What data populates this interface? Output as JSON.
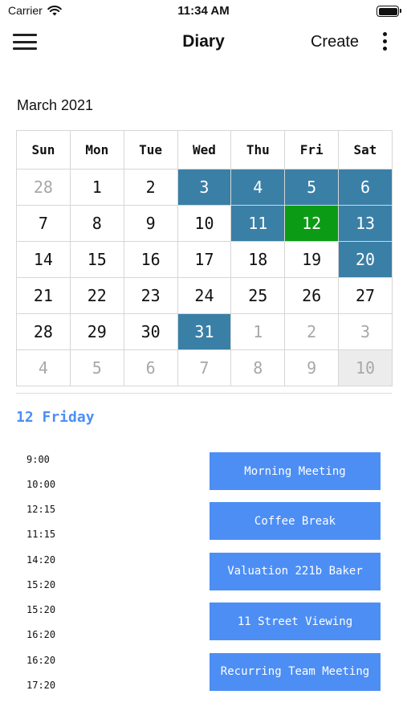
{
  "status_bar": {
    "carrier": "Carrier",
    "time": "11:34 AM",
    "battery_level": 1.0
  },
  "nav": {
    "title": "Diary",
    "create_label": "Create"
  },
  "calendar": {
    "month_label": "March 2021",
    "weekdays": [
      "Sun",
      "Mon",
      "Tue",
      "Wed",
      "Thu",
      "Fri",
      "Sat"
    ],
    "weeks": [
      [
        {
          "day": "28",
          "state": "muted"
        },
        {
          "day": "1",
          "state": "normal"
        },
        {
          "day": "2",
          "state": "normal"
        },
        {
          "day": "3",
          "state": "has-events"
        },
        {
          "day": "4",
          "state": "has-events"
        },
        {
          "day": "5",
          "state": "has-events"
        },
        {
          "day": "6",
          "state": "has-events"
        }
      ],
      [
        {
          "day": "7",
          "state": "normal"
        },
        {
          "day": "8",
          "state": "normal"
        },
        {
          "day": "9",
          "state": "normal"
        },
        {
          "day": "10",
          "state": "normal"
        },
        {
          "day": "11",
          "state": "has-events"
        },
        {
          "day": "12",
          "state": "selected"
        },
        {
          "day": "13",
          "state": "has-events"
        }
      ],
      [
        {
          "day": "14",
          "state": "normal"
        },
        {
          "day": "15",
          "state": "normal"
        },
        {
          "day": "16",
          "state": "normal"
        },
        {
          "day": "17",
          "state": "normal"
        },
        {
          "day": "18",
          "state": "normal"
        },
        {
          "day": "19",
          "state": "normal"
        },
        {
          "day": "20",
          "state": "has-events"
        }
      ],
      [
        {
          "day": "21",
          "state": "normal"
        },
        {
          "day": "22",
          "state": "normal"
        },
        {
          "day": "23",
          "state": "normal"
        },
        {
          "day": "24",
          "state": "normal"
        },
        {
          "day": "25",
          "state": "normal"
        },
        {
          "day": "26",
          "state": "normal"
        },
        {
          "day": "27",
          "state": "normal"
        }
      ],
      [
        {
          "day": "28",
          "state": "normal"
        },
        {
          "day": "29",
          "state": "normal"
        },
        {
          "day": "30",
          "state": "normal"
        },
        {
          "day": "31",
          "state": "has-events"
        },
        {
          "day": "1",
          "state": "muted"
        },
        {
          "day": "2",
          "state": "muted"
        },
        {
          "day": "3",
          "state": "muted"
        }
      ],
      [
        {
          "day": "4",
          "state": "muted"
        },
        {
          "day": "5",
          "state": "muted"
        },
        {
          "day": "6",
          "state": "muted"
        },
        {
          "day": "7",
          "state": "muted"
        },
        {
          "day": "8",
          "state": "muted"
        },
        {
          "day": "9",
          "state": "muted"
        },
        {
          "day": "10",
          "state": "today-muted"
        }
      ]
    ],
    "colors": {
      "has_events": "#3a7fa6",
      "selected": "#0c9b14",
      "grey": "#ececec",
      "accent": "#4d8ef5"
    }
  },
  "agenda": {
    "heading": "12 Friday",
    "events": [
      {
        "start": "9:00",
        "end": "10:00",
        "title": "Morning Meeting"
      },
      {
        "start": "12:15",
        "end": "11:15",
        "title": "Coffee Break"
      },
      {
        "start": "14:20",
        "end": "15:20",
        "title": "Valuation 221b Baker"
      },
      {
        "start": "15:20",
        "end": "16:20",
        "title": "11 Street Viewing"
      },
      {
        "start": "16:20",
        "end": "17:20",
        "title": "Recurring Team Meeting"
      }
    ]
  }
}
